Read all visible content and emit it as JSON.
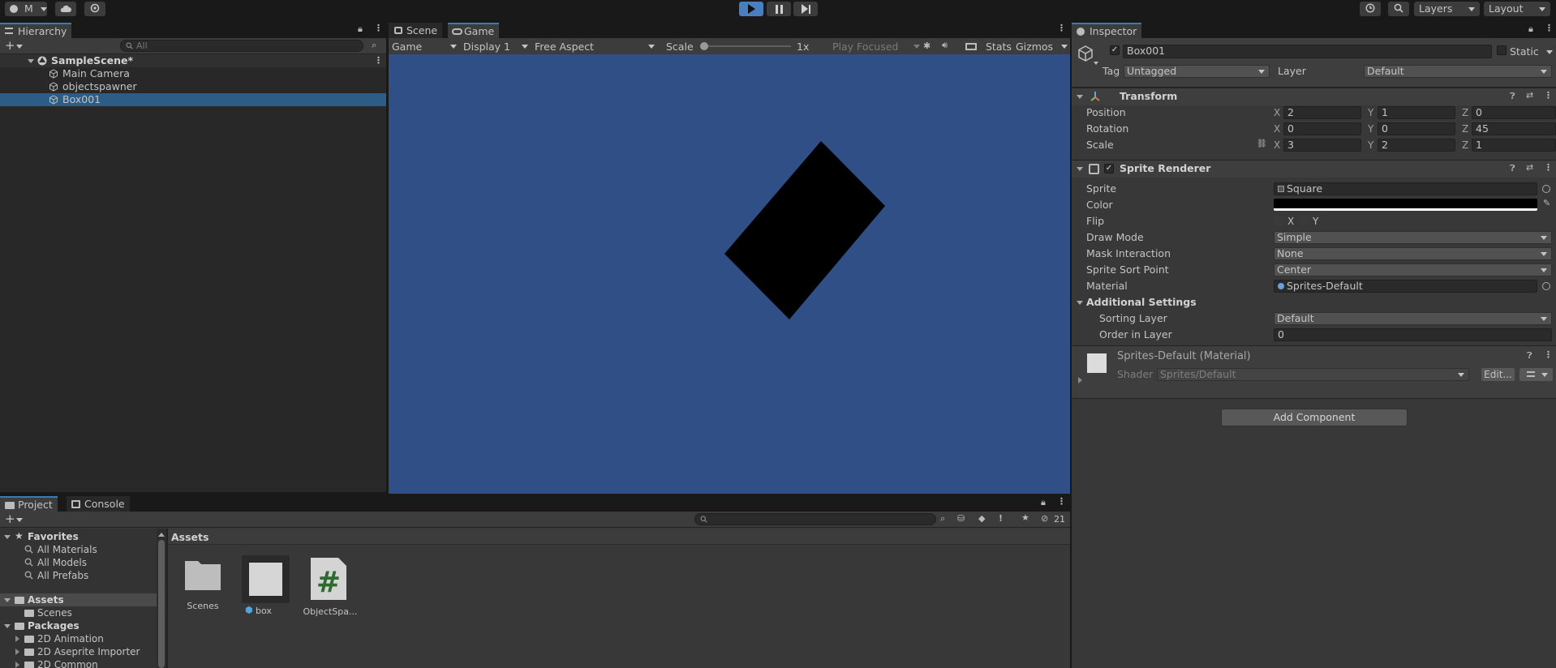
{
  "toolbar": {
    "account_label": "M",
    "layers_label": "Layers",
    "layout_label": "Layout"
  },
  "hierarchy": {
    "tab_label": "Hierarchy",
    "search_placeholder": "All",
    "scene_name": "SampleScene*",
    "items": [
      {
        "label": "Main Camera"
      },
      {
        "label": "objectspawner"
      },
      {
        "label": "Box001",
        "selected": true
      }
    ]
  },
  "game_view": {
    "tab_scene": "Scene",
    "tab_game": "Game",
    "mode_dropdown": "Game",
    "display_dropdown": "Display 1",
    "aspect_dropdown": "Free Aspect",
    "scale_label": "Scale",
    "scale_value": "1x",
    "scale_fraction": 0.0,
    "play_focused": "Play Focused",
    "stats_label": "Stats",
    "gizmos_label": "Gizmos",
    "background_color": "#2f4f86",
    "object_color": "#000000"
  },
  "inspector": {
    "tab_label": "Inspector",
    "object_name": "Box001",
    "static_label": "Static",
    "tag_label": "Tag",
    "tag_value": "Untagged",
    "layer_label": "Layer",
    "layer_value": "Default",
    "transform": {
      "title": "Transform",
      "position_label": "Position",
      "rotation_label": "Rotation",
      "scale_label": "Scale",
      "position": {
        "x": "2",
        "y": "1",
        "z": "0"
      },
      "rotation": {
        "x": "0",
        "y": "0",
        "z": "45"
      },
      "scale": {
        "x": "3",
        "y": "2",
        "z": "1"
      }
    },
    "axes": {
      "x": "X",
      "y": "Y",
      "z": "Z"
    },
    "sprite_renderer": {
      "title": "Sprite Renderer",
      "sprite_label": "Sprite",
      "sprite_value": "Square",
      "color_label": "Color",
      "color_value": "#000000",
      "flip_label": "Flip",
      "flip_x": "X",
      "flip_y": "Y",
      "draw_mode_label": "Draw Mode",
      "draw_mode_value": "Simple",
      "mask_label": "Mask Interaction",
      "mask_value": "None",
      "sort_point_label": "Sprite Sort Point",
      "sort_point_value": "Center",
      "material_label": "Material",
      "material_value": "Sprites-Default",
      "additional_label": "Additional Settings",
      "sorting_layer_label": "Sorting Layer",
      "sorting_layer_value": "Default",
      "order_label": "Order in Layer",
      "order_value": "0"
    },
    "material": {
      "title": "Sprites-Default (Material)",
      "shader_label": "Shader",
      "shader_value": "Sprites/Default",
      "edit_label": "Edit..."
    },
    "add_component": "Add Component"
  },
  "project": {
    "tab_project": "Project",
    "tab_console": "Console",
    "hidden_count": "21",
    "favorites_label": "Favorites",
    "favorites": [
      "All Materials",
      "All Models",
      "All Prefabs"
    ],
    "assets_label": "Assets",
    "assets_children": [
      "Scenes"
    ],
    "packages_label": "Packages",
    "packages": [
      "2D Animation",
      "2D Aseprite Importer",
      "2D Common"
    ],
    "breadcrumb": "Assets",
    "grid_items": [
      {
        "label": "Scenes"
      },
      {
        "label": "box"
      },
      {
        "label": "ObjectSpa..."
      }
    ]
  }
}
